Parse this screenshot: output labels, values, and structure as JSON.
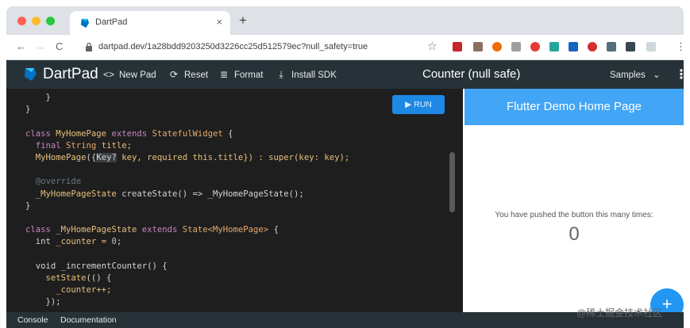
{
  "browser": {
    "tab_title": "DartPad",
    "tab_close": "×",
    "new_tab": "+",
    "nav": {
      "back": "←",
      "forward": "→",
      "reload": "C"
    },
    "url": "dartpad.dev/1a28bdd9203250d3226cc25d512579ec?null_safety=true",
    "bookmark": "☆",
    "menu": "⋮",
    "colors": {
      "close": "#ff5f57",
      "min": "#febc2e",
      "max": "#28c840"
    }
  },
  "appbar": {
    "brand": "DartPad",
    "new_pad": "New Pad",
    "new_pad_icon": "<>",
    "reset": "Reset",
    "reset_icon": "⟳",
    "format": "Format",
    "format_icon": "≣",
    "install_sdk": "Install SDK",
    "install_icon": "⤓",
    "title": "Counter (null safe)",
    "samples": "Samples",
    "samples_chevron": "⌄",
    "menu": "⋮"
  },
  "editor": {
    "run": "▶ RUN",
    "lines": {
      "l1": "    }",
      "l2": "}",
      "l3a": "class ",
      "l3b": "MyHomePage",
      "l3c": " extends ",
      "l3d": "StatefulWidget",
      "l3e": " {",
      "l4a": "  final ",
      "l4b": "String",
      "l4c": " title;",
      "l5a": "  MyHomePage",
      "l5b": "({",
      "l5c": "Key?",
      "l5d": " key, required this.title}) : super(key: key);",
      "l7": "  @override",
      "l8a": "  _MyHomePageState",
      "l8b": " createState() => _MyHomePageState();",
      "l9": "}",
      "l11a": "class ",
      "l11b": "_MyHomePageState",
      "l11c": " extends ",
      "l11d": "State<MyHomePage>",
      "l11e": " {",
      "l12a": "  int",
      "l12b": " _counter = ",
      "l12c": "0",
      "l12d": ";",
      "l14a": "  void",
      "l14b": " _incrementCounter() {",
      "l15a": "    setState",
      "l15b": "(() {",
      "l16": "      _counter++;",
      "l17": "    });"
    }
  },
  "preview": {
    "title": "Flutter Demo Home Page",
    "message": "You have pushed the button this many times:",
    "counter": "0",
    "fab": "+"
  },
  "bottombar": {
    "console": "Console",
    "documentation": "Documentation"
  },
  "watermark": "@稀土掘金技术社区"
}
